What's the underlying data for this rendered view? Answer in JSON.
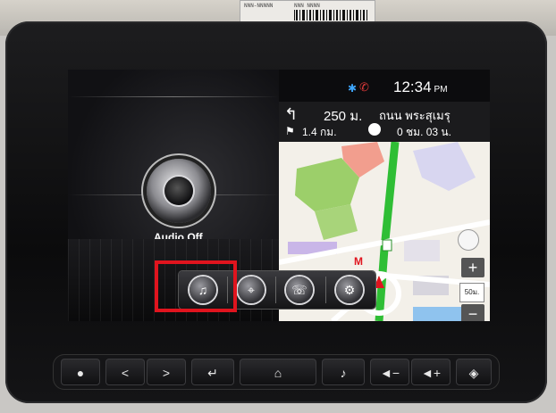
{
  "device": {
    "name": "car head unit"
  },
  "sticker": {
    "line1": "NNN-NNNNN",
    "line2": "NNN NNNN"
  },
  "status": {
    "time": "12:34",
    "ampm": "PM",
    "bluetooth_icon": "bluetooth-icon",
    "phone_icon": "phone-off-icon"
  },
  "audio": {
    "label": "Audio Off",
    "icon": "speaker-icon"
  },
  "nav": {
    "turn_distance": "250 ม.",
    "street": "ถนน พระสุเมรุ",
    "trip_distance": "1.4 กม.",
    "eta": "0 ชม. 03 น.",
    "turn_icon": "turn-left-icon",
    "flag_icon": "destination-flag-icon",
    "clock_icon": "clock-icon",
    "zoom_in": "+",
    "zoom_out": "−",
    "scale": "50ม.",
    "accent": "#e0141e"
  },
  "dock": {
    "items": [
      {
        "name": "music-icon",
        "glyph": "♫"
      },
      {
        "name": "navigation-icon",
        "glyph": "⌖"
      },
      {
        "name": "phone-icon",
        "glyph": "☏"
      },
      {
        "name": "settings-icon",
        "glyph": "⚙"
      }
    ]
  },
  "hardware": {
    "buttons": [
      {
        "name": "location-icon",
        "glyph": "●"
      },
      {
        "name": "prev-icon",
        "glyph": "<"
      },
      {
        "name": "next-icon",
        "glyph": ">"
      },
      {
        "name": "back-icon",
        "glyph": "↵"
      },
      {
        "name": "home-icon",
        "glyph": "⌂"
      },
      {
        "name": "media-power-icon",
        "glyph": "♪"
      },
      {
        "name": "volume-down-icon",
        "glyph": "◄−"
      },
      {
        "name": "volume-up-icon",
        "glyph": "◄+"
      },
      {
        "name": "nav-icon",
        "glyph": "◈"
      }
    ]
  }
}
